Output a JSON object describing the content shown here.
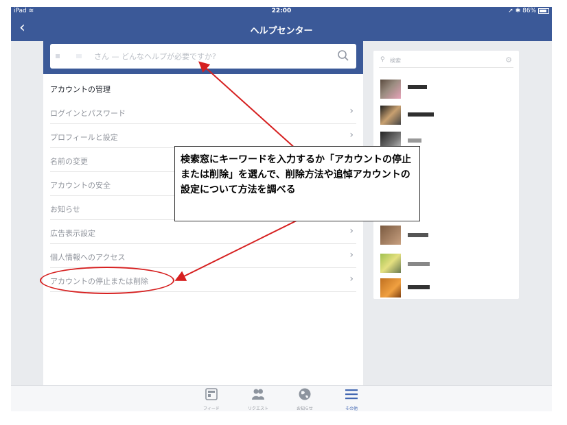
{
  "status_bar": {
    "device": "iPad",
    "wifi_icon": "wifi-icon",
    "time": "22:00",
    "battery": "86%"
  },
  "nav": {
    "back_icon": "chevron-left-icon",
    "title": "ヘルプセンター"
  },
  "search": {
    "placeholder": "さん — どんなヘルプが必要ですか?",
    "icon": "search-icon"
  },
  "section_title": "アカウントの管理",
  "menu_items": [
    {
      "label": "ログインとパスワード"
    },
    {
      "label": "プロフィールと設定"
    },
    {
      "label": "名前の変更"
    },
    {
      "label": "アカウントの安全"
    },
    {
      "label": "お知らせ"
    },
    {
      "label": "広告表示設定"
    },
    {
      "label": "個人情報へのアクセス"
    },
    {
      "label": "アカウントの停止または削除"
    }
  ],
  "sidebar": {
    "search_placeholder": "検索",
    "settings_icon": "gear-icon"
  },
  "tabs": [
    {
      "label": "フィード",
      "icon": "feed-icon",
      "active": false
    },
    {
      "label": "リクエスト",
      "icon": "friends-icon",
      "active": false
    },
    {
      "label": "お知らせ",
      "icon": "globe-icon",
      "active": false
    },
    {
      "label": "その他",
      "icon": "menu-icon",
      "active": true
    }
  ],
  "annotation": {
    "callout_text": "検索窓にキーワードを入力するか「アカウントの停止または削除」を選んで、削除方法や追悼アカウントの設定について方法を調べる",
    "highlight_color": "#d62020"
  },
  "colors": {
    "brand": "#3b5998",
    "active_tab": "#4267b2",
    "annotation": "#d62020"
  }
}
